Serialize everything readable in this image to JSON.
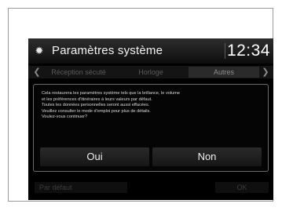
{
  "header": {
    "title": "Paramètres système",
    "clock": "12:34"
  },
  "tabs": [
    {
      "label": "Réception sécuté",
      "active": false
    },
    {
      "label": "Horloge",
      "active": false
    },
    {
      "label": "Autres",
      "active": true
    }
  ],
  "dialog": {
    "lines": [
      "Cela restaurera les paramètres système tels que la brillance, le volume",
      "et les préférences d'itinéraires à leurs valeurs par défaut.",
      "Toutes les données personnelles seront aussi effacées.",
      "Veuillez consulter le mode d'emploi pour plus de détails.",
      "Voulez-vous continuer?"
    ],
    "yes_label": "Oui",
    "no_label": "Non"
  },
  "footer": {
    "default_label": "Par défaut",
    "ok_label": "OK"
  },
  "icons": {
    "header": "gear-icon",
    "left_arrow": "chevron-left-icon",
    "right_arrow": "chevron-right-icon"
  }
}
